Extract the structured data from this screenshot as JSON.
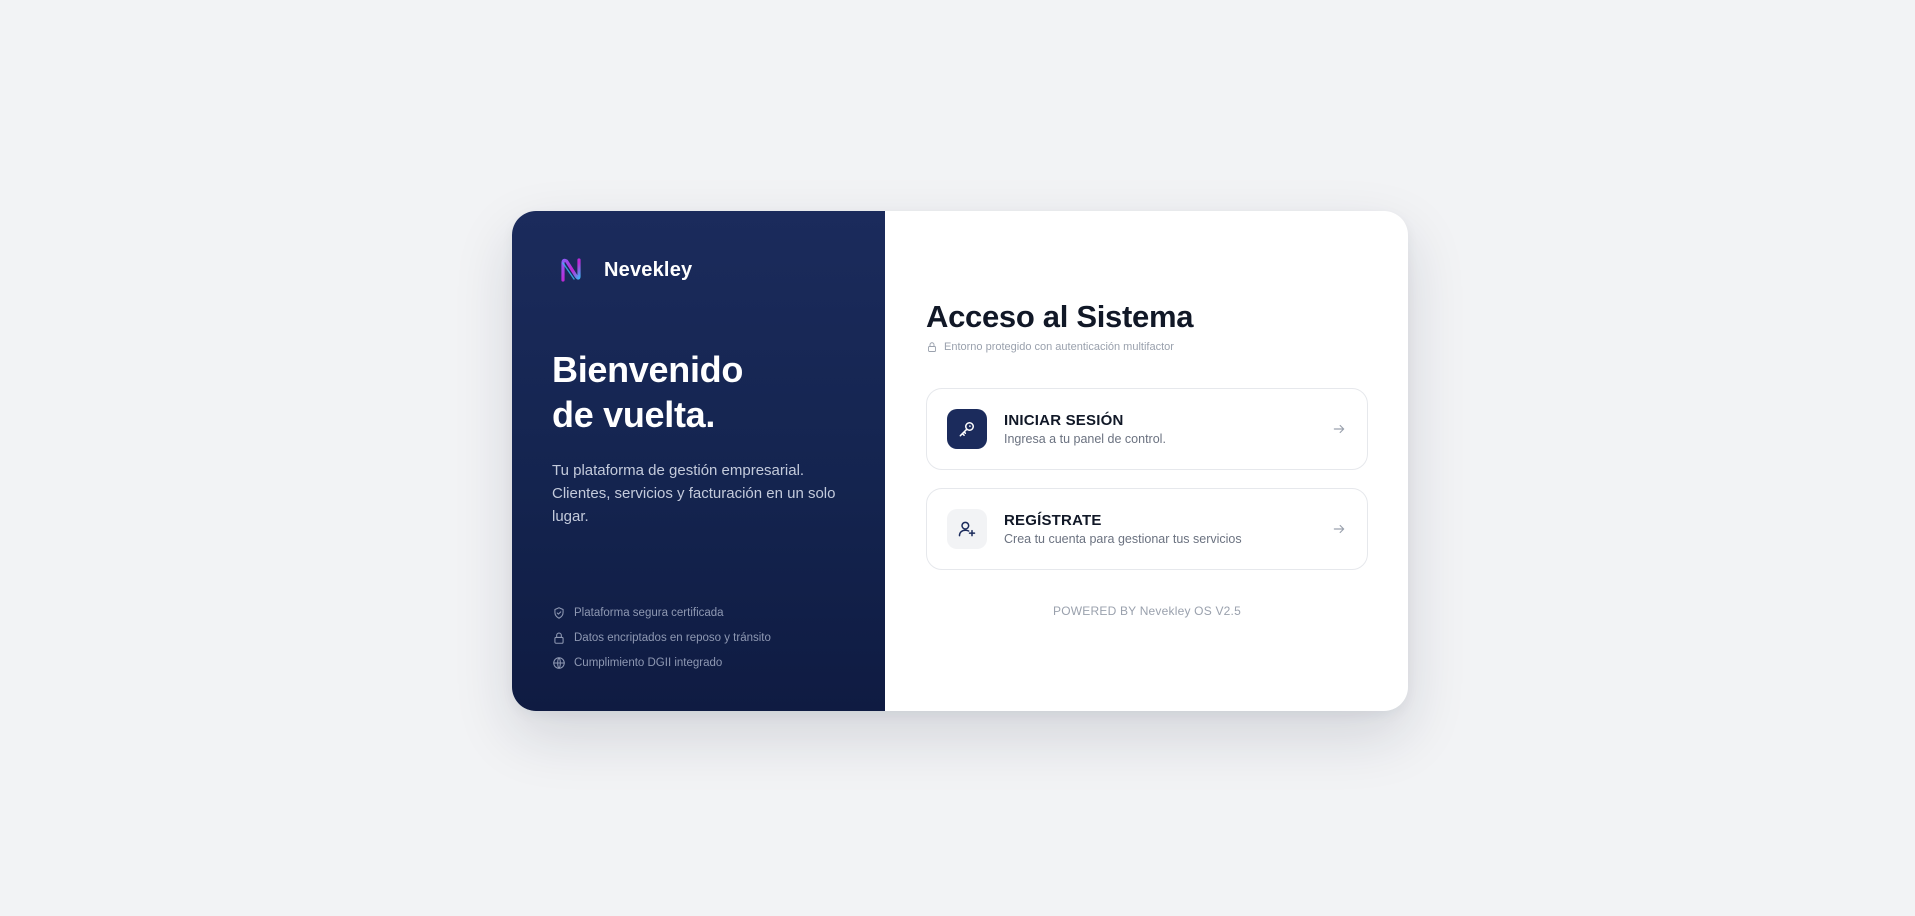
{
  "brand": {
    "name": "Nevekley",
    "logo_icon": "n-logo-icon"
  },
  "left_panel": {
    "welcome_line1": "Bienvenido",
    "welcome_line2": "de vuelta.",
    "tagline": "Tu plataforma de gestión empresarial. Clientes, servicios y facturación en un solo lugar.",
    "features": [
      {
        "icon": "shield-icon",
        "text": "Plataforma segura certificada"
      },
      {
        "icon": "lock-icon",
        "text": "Datos encriptados en reposo y tránsito"
      },
      {
        "icon": "globe-icon",
        "text": "Cumplimiento DGII integrado"
      }
    ]
  },
  "right_panel": {
    "title": "Acceso al Sistema",
    "subtitle": "Entorno protegido con autenticación multifactor",
    "login": {
      "title": "INICIAR SESIÓN",
      "description": "Ingresa a tu panel de control.",
      "icon": "key-icon"
    },
    "register": {
      "title": "REGÍSTRATE",
      "description": "Crea tu cuenta para gestionar tus servicios",
      "icon": "user-plus-icon"
    },
    "footer": "POWERED BY Nevekley OS V2.5"
  },
  "colors": {
    "page_background": "#f2f3f5",
    "panel_navy": "#1b2b5c",
    "text_dark": "#111827",
    "text_muted": "#6b7280"
  }
}
